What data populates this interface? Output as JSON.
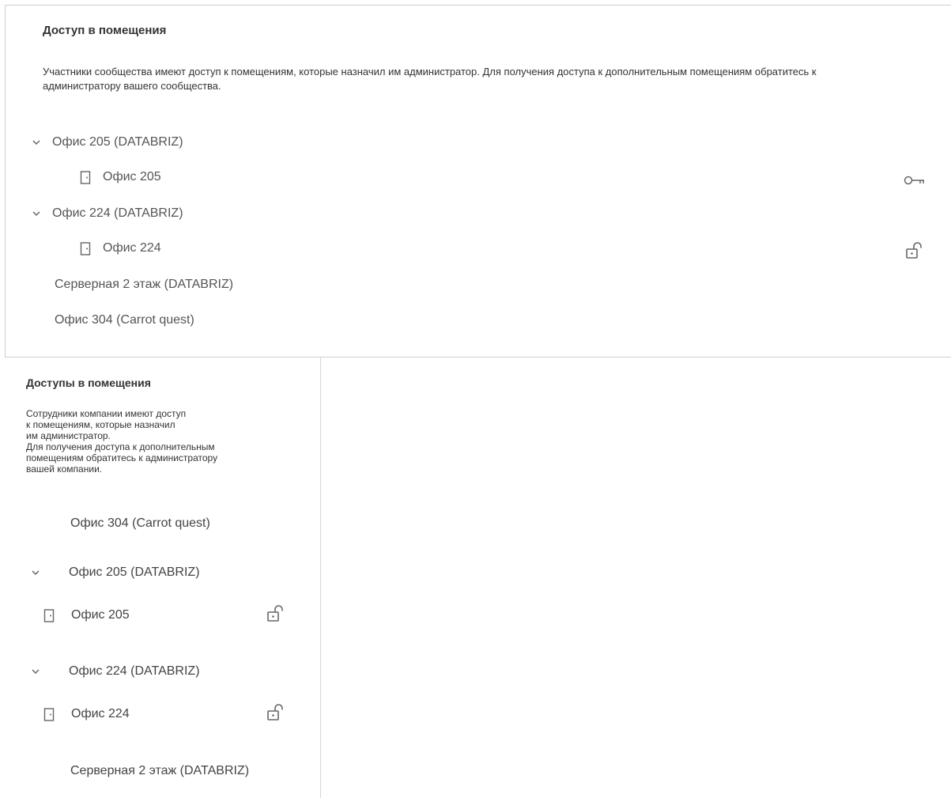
{
  "desktop": {
    "title": "Доступ в помещения",
    "description": "Участники сообщества имеют доступ к помещениям, которые назначил им администратор. Для получения доступа к дополнительным помещениям обратитесь к администратору вашего сообщества.",
    "tree": [
      {
        "label": "Офис 205 (DATABRIZ)",
        "expanded": true,
        "children": [
          {
            "label": "Офис 205",
            "action_icon": "key-icon"
          }
        ]
      },
      {
        "label": "Офис 224 (DATABRIZ)",
        "expanded": true,
        "children": [
          {
            "label": "Офис 224",
            "action_icon": "lock-open-icon"
          }
        ]
      },
      {
        "label": "Серверная 2 этаж (DATABRIZ)"
      },
      {
        "label": "Офис 304 (Carrot quest)"
      }
    ]
  },
  "mobile": {
    "title": "Доступы в помещения",
    "description_lines": [
      "Сотрудники компании имеют доступ",
      "к помещениям, которые назначил",
      "им администратор.",
      "Для получения доступа к дополнительным",
      "помещениям обратитесь к администратору",
      "вашей компании."
    ],
    "tree": [
      {
        "label": "Офис 304 (Carrot quest)"
      },
      {
        "label": "Офис 205 (DATABRIZ)",
        "expanded": true,
        "children": [
          {
            "label": "Офис 205",
            "action_icon": "lock-open-icon"
          }
        ]
      },
      {
        "label": "Офис 224 (DATABRIZ)",
        "expanded": true,
        "children": [
          {
            "label": "Офис 224",
            "action_icon": "lock-open-icon"
          }
        ]
      },
      {
        "label": "Серверная 2 этаж (DATABRIZ)"
      }
    ]
  },
  "colors": {
    "text": "#333333",
    "muted": "#555555",
    "icon": "#666666",
    "border": "#cfcfcf"
  }
}
